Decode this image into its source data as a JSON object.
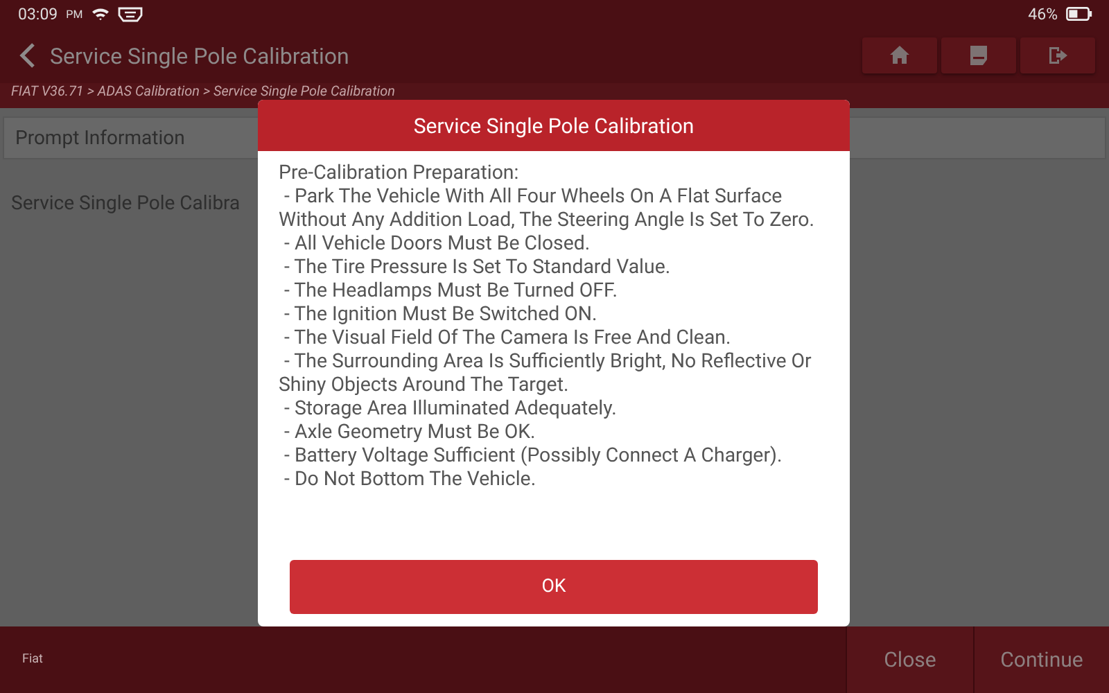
{
  "status_bar": {
    "time": "03:09",
    "ampm": "PM",
    "battery": "46%"
  },
  "title_bar": {
    "title": "Service Single Pole Calibration"
  },
  "breadcrumb": "FIAT V36.71 > ADAS Calibration > Service Single Pole Calibration",
  "panel": {
    "header": "Prompt Information",
    "text": "Service Single Pole Calibra"
  },
  "footer": {
    "label": "Fiat",
    "buttons": [
      "Close",
      "Continue"
    ]
  },
  "dialog": {
    "title": "Service Single Pole Calibration",
    "heading": "Pre-Calibration Preparation:",
    "items": [
      "- Park The Vehicle With All Four Wheels On A Flat Surface Without Any Addition Load, The Steering Angle Is Set To Zero.",
      "- All Vehicle Doors Must Be Closed.",
      "- The Tire Pressure Is Set To Standard Value.",
      "- The Headlamps Must Be Turned OFF.",
      "- The Ignition Must Be Switched ON.",
      "- The Visual Field Of The Camera Is Free And Clean.",
      "- The Surrounding Area Is Sufficiently Bright, No Reflective Or Shiny Objects Around The Target.",
      "- Storage Area Illuminated Adequately.",
      "- Axle Geometry Must Be OK.",
      "- Battery Voltage Sufficient (Possibly Connect A Charger).",
      "- Do Not Bottom The Vehicle."
    ],
    "button": "OK"
  }
}
